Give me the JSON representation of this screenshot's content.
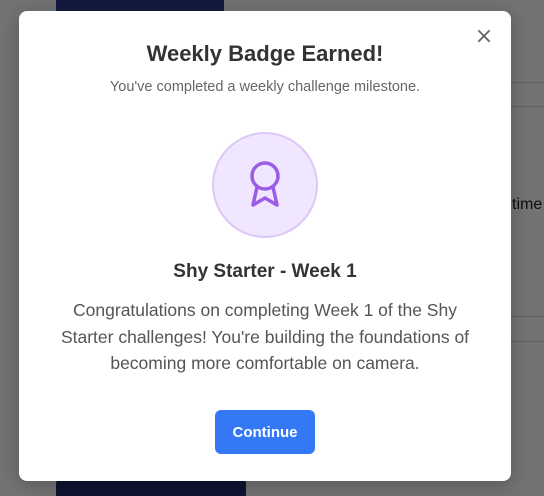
{
  "background": {
    "partial_text": "time"
  },
  "modal": {
    "close_symbol": "×",
    "title": "Weekly Badge Earned!",
    "subtitle": "You've completed a weekly challenge milestone.",
    "badge_icon": "award-ribbon-icon",
    "badge_name": "Shy Starter - Week 1",
    "description": "Congratulations on completing Week 1 of the Shy Starter challenges! You're building the foundations of becoming more comfortable on camera.",
    "continue_label": "Continue"
  },
  "colors": {
    "accent": "#3478f6",
    "badge_bg": "#f0e6ff",
    "badge_icon": "#9b5de5"
  }
}
